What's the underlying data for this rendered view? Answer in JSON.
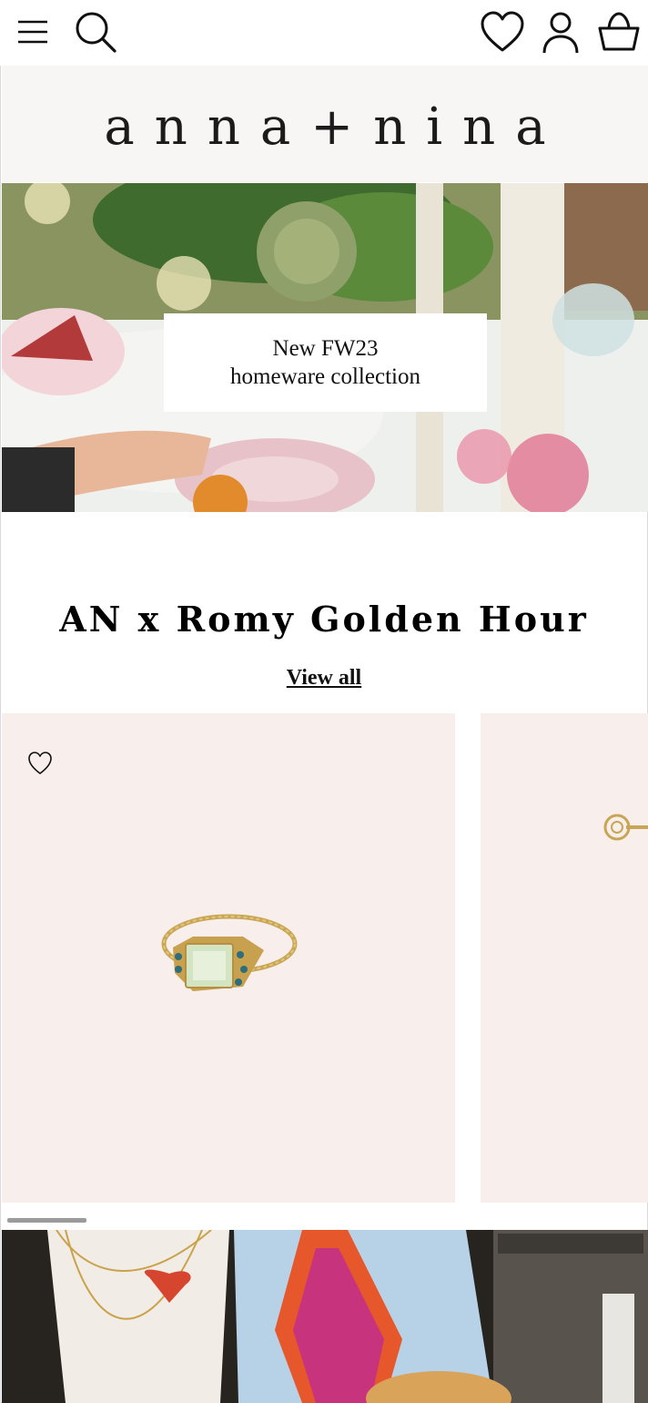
{
  "header": {
    "icons": [
      "hamburger-menu-icon",
      "search-icon",
      "heart-icon",
      "account-icon",
      "basket-icon"
    ]
  },
  "brand": {
    "logo": "anna+nina"
  },
  "hero": {
    "line1": "New FW23",
    "line2": "homeware collection"
  },
  "collection": {
    "title": "AN x Romy Golden Hour",
    "view_all": "View all"
  },
  "carousel": {
    "scroll_progress": 0.125
  },
  "colors": {
    "logo_band": "#f8f6f4",
    "card_bg": "#f8efec",
    "text": "#111111",
    "scrollbar": "#9b9b9b"
  }
}
